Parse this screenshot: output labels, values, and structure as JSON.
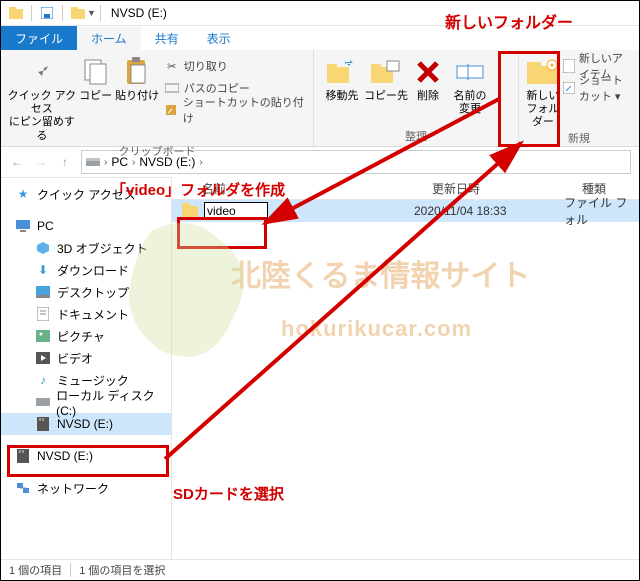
{
  "title": "NVSD (E:)",
  "tabs": {
    "file": "ファイル",
    "home": "ホーム",
    "share": "共有",
    "view": "表示"
  },
  "ribbon": {
    "quick_access": "クイック アクセス\nにピン留めする",
    "copy": "コピー",
    "paste": "貼り付け",
    "cut": "切り取り",
    "copy_path": "パスのコピー",
    "paste_shortcut": "ショートカットの貼り付け",
    "clipboard_label": "クリップボード",
    "move_to": "移動先",
    "copy_to": "コピー先",
    "delete": "削除",
    "rename": "名前の\n変更",
    "organize_label": "整理",
    "new_folder": "新しい\nフォルダー",
    "new_item": "新しいアイテム",
    "shortcut": "ショートカット ▾",
    "new_label": "新規"
  },
  "breadcrumb": {
    "pc": "PC",
    "drive": "NVSD (E:)"
  },
  "sidebar": {
    "quick": "クイック アクセス",
    "pc": "PC",
    "obj3d": "3D オブジェクト",
    "downloads": "ダウンロード",
    "desktop": "デスクトップ",
    "documents": "ドキュメント",
    "pictures": "ピクチャ",
    "videos": "ビデオ",
    "music": "ミュージック",
    "localc": "ローカル ディスク (C:)",
    "nvsd1": "NVSD (E:)",
    "nvsd2": "NVSD (E:)",
    "network": "ネットワーク"
  },
  "columns": {
    "name": "名前",
    "date": "更新日時",
    "type": "種類"
  },
  "row": {
    "value": "video",
    "date": "2020/11/04 18:33",
    "type": "ファイル フォル"
  },
  "status": {
    "count": "1 個の項目",
    "sel": "1 個の項目を選択"
  },
  "annot": {
    "new_folder_label": "新しいフォルダー",
    "create_video": "「video」フォルダを作成",
    "select_sd": "SDカードを選択",
    "wm1": "北陸くるま情報サイト",
    "wm2": "hokurikucar.com"
  }
}
